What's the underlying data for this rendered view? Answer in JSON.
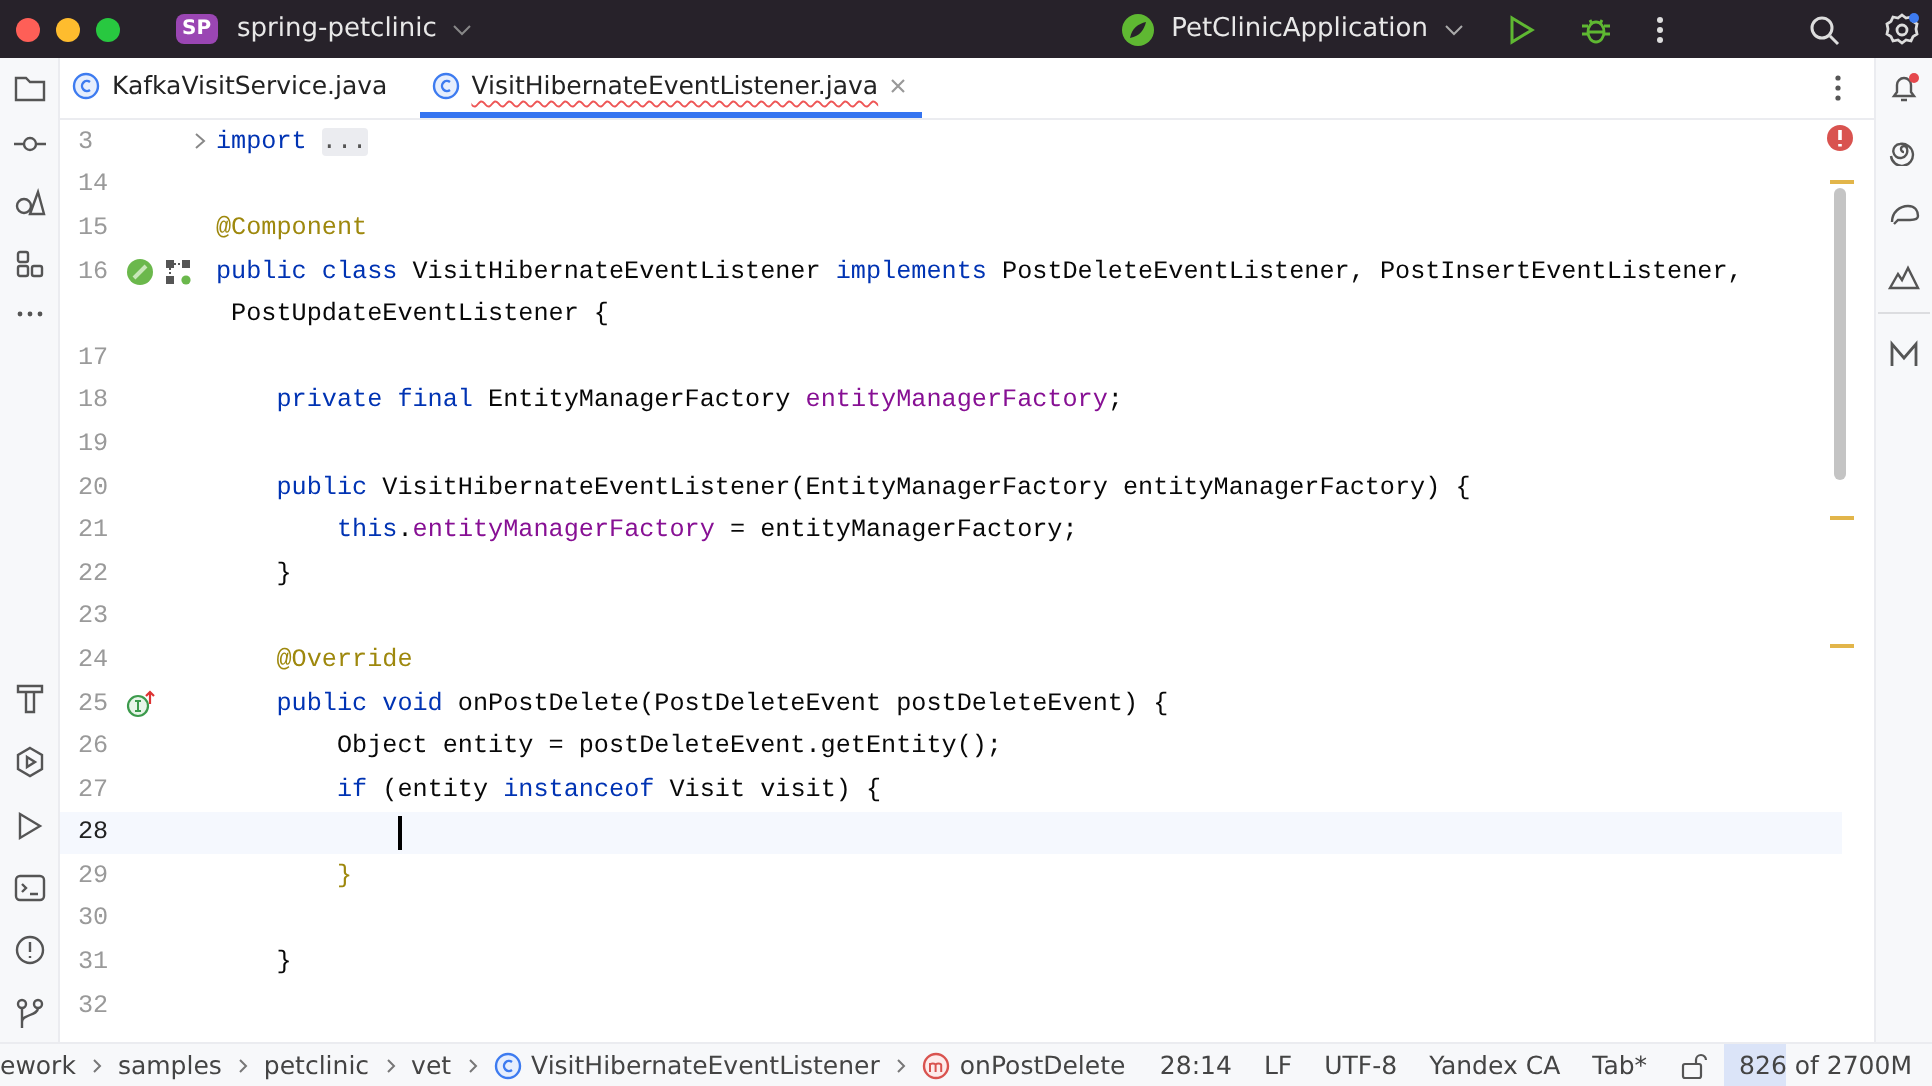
{
  "title_bar": {
    "project_badge": "SP",
    "project": "spring-petclinic",
    "run_config": "PetClinicApplication",
    "settings_badge": true
  },
  "tabs": [
    {
      "label": "KafkaVisitService.java",
      "selected": false,
      "has_errors": false
    },
    {
      "label": "VisitHibernateEventListener.java",
      "selected": true,
      "has_errors": true
    }
  ],
  "notifications": {
    "unread": true
  },
  "editor": {
    "has_error": true,
    "lines": [
      {
        "kind": "code",
        "number": "3",
        "folded": true,
        "tokens": [
          {
            "text": "import ",
            "kind": "keyword"
          },
          {
            "text": "...",
            "kind": "fold"
          }
        ]
      },
      {
        "kind": "code",
        "number": "14"
      },
      {
        "kind": "code",
        "number": "15",
        "tokens": [
          {
            "text": "@Component",
            "kind": "annotation"
          }
        ]
      },
      {
        "kind": "code",
        "number": "16",
        "gutter_icons": [
          {
            "kind": "bean"
          },
          {
            "kind": "diagram"
          }
        ],
        "tokens": [
          {
            "text": "public class ",
            "kind": "keyword"
          },
          {
            "text": "VisitHibernateEventListener ",
            "kind": "plain"
          },
          {
            "text": "implements ",
            "kind": "keyword"
          },
          {
            "text": "PostDeleteEventListener, PostInsertEventListener,",
            "kind": "plain"
          }
        ]
      },
      {
        "kind": "wrap",
        "tokens": [
          {
            "text": " PostUpdateEventListener {",
            "kind": "plain"
          }
        ]
      },
      {
        "kind": "code",
        "number": "17"
      },
      {
        "kind": "code",
        "number": "18",
        "tokens": [
          {
            "text": "    private final ",
            "kind": "keyword"
          },
          {
            "text": "EntityManagerFactory ",
            "kind": "plain"
          },
          {
            "text": "entityManagerFactory",
            "kind": "field"
          },
          {
            "text": ";",
            "kind": "plain"
          }
        ]
      },
      {
        "kind": "code",
        "number": "19"
      },
      {
        "kind": "code",
        "number": "20",
        "tokens": [
          {
            "text": "    public ",
            "kind": "keyword"
          },
          {
            "text": "VisitHibernateEventListener(EntityManagerFactory entityManagerFactory) {",
            "kind": "plain"
          }
        ]
      },
      {
        "kind": "code",
        "number": "21",
        "tokens": [
          {
            "text": "        this",
            "kind": "keyword"
          },
          {
            "text": ".",
            "kind": "plain"
          },
          {
            "text": "entityManagerFactory",
            "kind": "field"
          },
          {
            "text": " = entityManagerFactory;",
            "kind": "plain"
          }
        ]
      },
      {
        "kind": "code",
        "number": "22",
        "tokens": [
          {
            "text": "    }",
            "kind": "plain"
          }
        ]
      },
      {
        "kind": "code",
        "number": "23"
      },
      {
        "kind": "code",
        "number": "24",
        "tokens": [
          {
            "text": "    @Override",
            "kind": "annotation"
          }
        ]
      },
      {
        "kind": "code",
        "number": "25",
        "gutter_icons": [
          {
            "kind": "implements"
          }
        ],
        "tokens": [
          {
            "text": "    public void ",
            "kind": "keyword"
          },
          {
            "text": "onPostDelete(PostDeleteEvent postDeleteEvent) {",
            "kind": "plain"
          }
        ]
      },
      {
        "kind": "code",
        "number": "26",
        "tokens": [
          {
            "text": "        Object entity = postDeleteEvent.getEntity();",
            "kind": "plain"
          }
        ]
      },
      {
        "kind": "code",
        "number": "27",
        "tokens": [
          {
            "text": "        if ",
            "kind": "keyword"
          },
          {
            "text": "(entity ",
            "kind": "plain"
          },
          {
            "text": "instanceof ",
            "kind": "keyword"
          },
          {
            "text": "Visit visit) {",
            "kind": "plain"
          }
        ]
      },
      {
        "kind": "code",
        "number": "28",
        "current": true
      },
      {
        "kind": "code",
        "number": "29",
        "tokens": [
          {
            "text": "        }",
            "kind": "brace"
          }
        ]
      },
      {
        "kind": "code",
        "number": "30"
      },
      {
        "kind": "code",
        "number": "31",
        "tokens": [
          {
            "text": "    }",
            "kind": "plain"
          }
        ]
      },
      {
        "kind": "code",
        "number": "32"
      }
    ]
  },
  "status_bar": {
    "breadcrumbs": [
      {
        "label": "ework",
        "kind": "folder"
      },
      {
        "label": "samples",
        "kind": "folder"
      },
      {
        "label": "petclinic",
        "kind": "folder"
      },
      {
        "label": "vet",
        "kind": "folder"
      },
      {
        "label": "VisitHibernateEventListener",
        "kind": "class"
      },
      {
        "label": "onPostDelete",
        "kind": "method"
      }
    ],
    "position": "28:14",
    "line_separator": "LF",
    "encoding": "UTF-8",
    "format": "Yandex CA",
    "indent": "Tab*",
    "memory": {
      "text": "826 of 2700M",
      "level": 0.31
    }
  }
}
